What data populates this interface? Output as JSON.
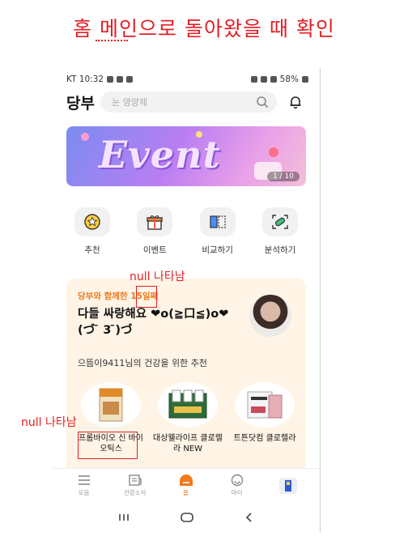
{
  "slide": {
    "title": "홈 메인으로 돌아왔을 때 확인"
  },
  "status_bar": {
    "carrier_time": "KT 10:32",
    "battery": "58%"
  },
  "header": {
    "logo": "당부",
    "search_placeholder": "눈 영양제"
  },
  "banner": {
    "word": "Event",
    "page_indicator": "1 / 10"
  },
  "quick_menu": [
    {
      "label": "추천",
      "icon": "medal-icon"
    },
    {
      "label": "이벤트",
      "icon": "gift-icon"
    },
    {
      "label": "비교하기",
      "icon": "compare-icon"
    },
    {
      "label": "분석하기",
      "icon": "capsule-scan-icon"
    }
  ],
  "card": {
    "subtitle": "당부와 함께한 15일째",
    "greeting": "다들 싸랑해요 ❤o(≧口≦)o❤ (づ ̄ 3 ̄)づ",
    "recommend_title": "으뜸이9411님의 건강을 위한 추천",
    "products": [
      {
        "name": "프롬바이오 신 바이오틱스"
      },
      {
        "name": "대상웰라이프 클로렐라 NEW"
      },
      {
        "name": "트튼닷컴 클로렐라"
      }
    ]
  },
  "bottom_nav": [
    {
      "label": "모음",
      "icon": "menu-icon"
    },
    {
      "label": "건강소식",
      "icon": "news-icon"
    },
    {
      "label": "홈",
      "icon": "home-icon",
      "active": true
    },
    {
      "label": "마이",
      "icon": "smile-icon"
    },
    {
      "label": "",
      "icon": "app-badge-icon"
    }
  ],
  "annotations": {
    "top_note": "null 나타남",
    "left_note": "null 나타남"
  },
  "colors": {
    "accent": "#f07a1c",
    "annotation": "#e31e24",
    "card_bg": "#fff4e6"
  }
}
